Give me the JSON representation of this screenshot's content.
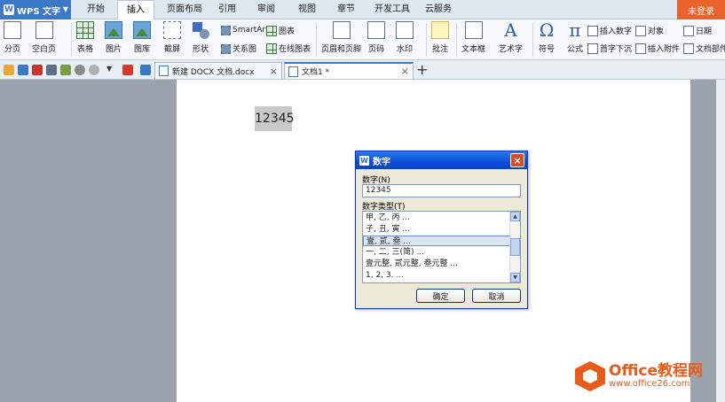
{
  "app": {
    "title": "WPS 文字",
    "logo_letter": "W",
    "login": "未登录"
  },
  "menu": {
    "tabs": [
      {
        "label": "开始"
      },
      {
        "label": "插入"
      },
      {
        "label": "页面布局"
      },
      {
        "label": "引用"
      },
      {
        "label": "审阅"
      },
      {
        "label": "视图"
      },
      {
        "label": "章节"
      },
      {
        "label": "开发工具"
      },
      {
        "label": "云服务"
      }
    ],
    "active_index": 1
  },
  "ribbon": {
    "page_break": "分页",
    "blank_page": "空白页",
    "table": "表格",
    "picture": "图片",
    "gallery": "图库",
    "screenshot": "截屏",
    "shapes": "形状",
    "smartart": "SmartArt",
    "relation": "关系图",
    "chart": "图表",
    "online_chart": "在线图表",
    "header_footer": "页眉和页脚",
    "page_number": "页码",
    "watermark": "水印",
    "comment": "批注",
    "textbox": "文本框",
    "wordart": "艺术字",
    "symbol": "符号",
    "formula": "公式",
    "insert_number": "插入数字",
    "object": "对象",
    "drop_cap": "首字下沉",
    "attachment": "插入附件",
    "date": "日期",
    "doc_parts": "文档部件"
  },
  "doc_tabs": [
    {
      "label": "新建 DOCX 文档.docx",
      "close": "×"
    },
    {
      "label": "文档1 *",
      "close": "×"
    }
  ],
  "new_tab_symbol": "+",
  "document": {
    "text": "12345"
  },
  "dialog": {
    "title": "数字",
    "close": "×",
    "number_label": "数字(N)",
    "number_value": "12345",
    "type_label": "数字类型(T)",
    "types": [
      "甲, 乙, 丙 ...",
      "子, 丑, 寅 ...",
      "壹, 贰, 叁 ...",
      "一, 二, 三(简) ...",
      "壹元整, 贰元整, 叁元整 ...",
      "1, 2, 3. ..."
    ],
    "selected_index": 2,
    "ok": "确定",
    "cancel": "取消",
    "scroll_up": "▲",
    "scroll_down": "▼"
  },
  "watermark": {
    "title": "Office教程网",
    "url": "www.office26.com"
  },
  "colors": {
    "accent": "#3b78c5",
    "login_bg": "#e8622a",
    "dialog_title": "#0b4fd6",
    "watermark": "#e85b1a"
  }
}
